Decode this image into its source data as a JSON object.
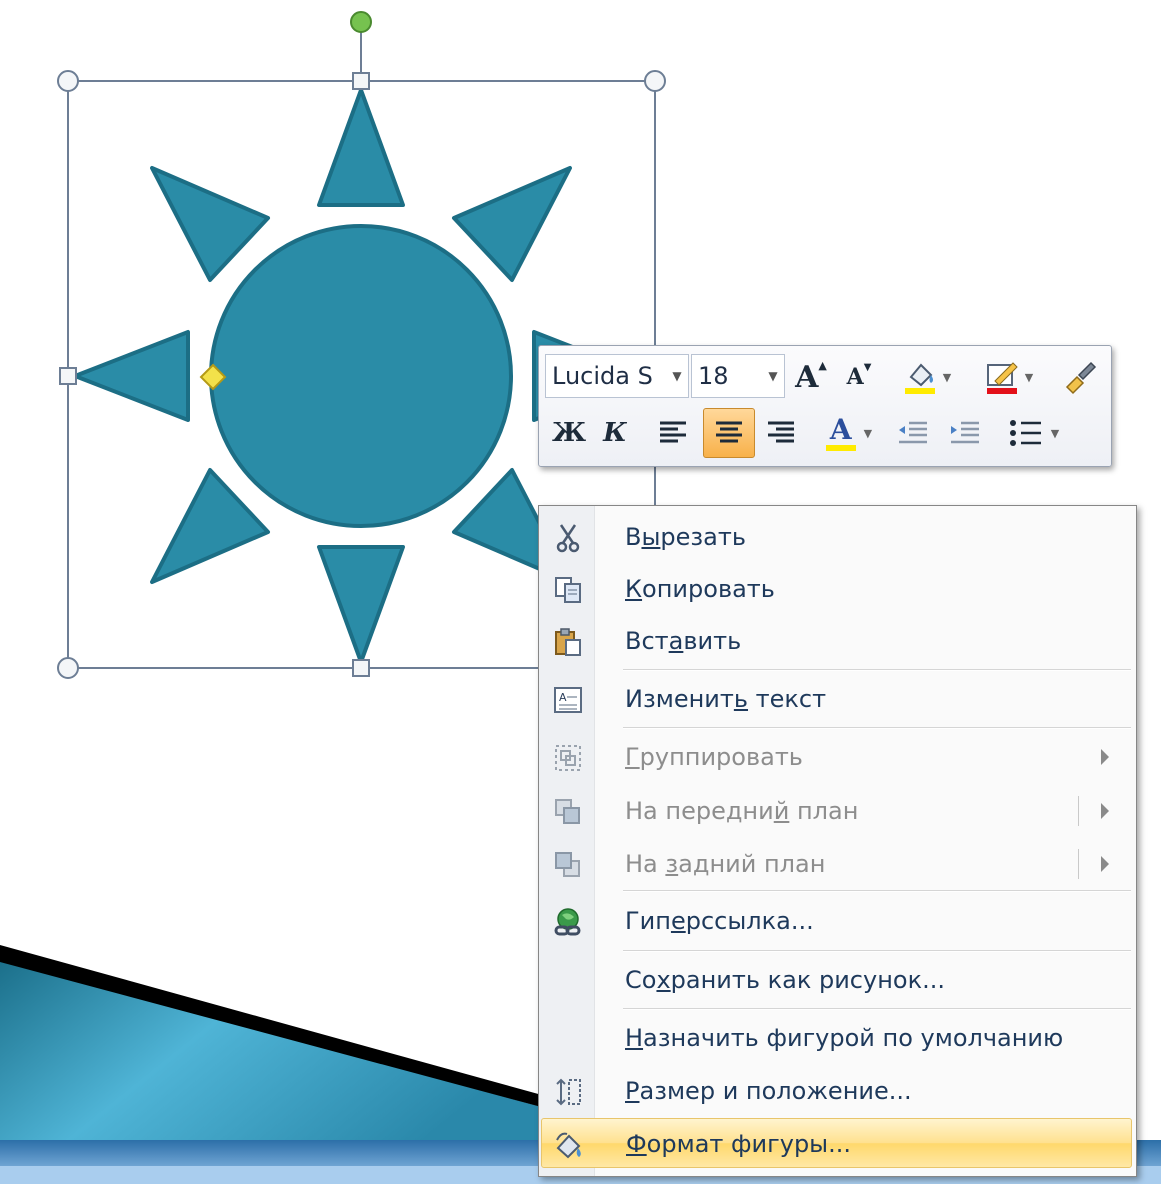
{
  "colors": {
    "shape_fill": "#2a8ca7",
    "shape_stroke": "#1c6e85",
    "menu_highlight": "#ffd86b",
    "menu_text": "#1e395b",
    "disabled_text": "#8d8d8d"
  },
  "mini_toolbar": {
    "font_name": "Lucida S",
    "font_size": "18",
    "row1_icons": [
      "grow-font-icon",
      "shrink-font-icon",
      "fill-color-icon",
      "line-color-icon",
      "format-painter-icon"
    ],
    "row2_icons": [
      "bold-icon",
      "italic-icon",
      "align-left-icon",
      "align-center-icon",
      "align-right-icon",
      "font-color-icon",
      "decrease-indent-icon",
      "increase-indent-icon",
      "bullets-icon"
    ],
    "bold_glyph": "Ж",
    "italic_glyph": "К",
    "font_color_glyph": "A",
    "grow_glyph": "A",
    "shrink_glyph": "A",
    "active_button": "align-center"
  },
  "context_menu": {
    "items": [
      {
        "key": "cut",
        "before": "В",
        "u": "ы",
        "after": "резать",
        "icon": "scissors-icon",
        "disabled": false
      },
      {
        "key": "copy",
        "before": "",
        "u": "К",
        "after": "опировать",
        "icon": "copy-icon",
        "disabled": false
      },
      {
        "key": "paste",
        "before": "Вст",
        "u": "а",
        "after": "вить",
        "icon": "paste-icon",
        "disabled": false
      },
      {
        "key": "edit-text",
        "before": "Изменит",
        "u": "ь",
        "after": " текст",
        "icon": "edit-text-icon",
        "disabled": false
      },
      {
        "key": "group",
        "before": "",
        "u": "Г",
        "after": "руппировать",
        "icon": "group-icon",
        "disabled": true,
        "submenu": true
      },
      {
        "key": "bring-front",
        "before": "На передни",
        "u": "й",
        "after": " план",
        "icon": "bring-front-icon",
        "disabled": true,
        "submenu": true
      },
      {
        "key": "send-back",
        "before": "На ",
        "u": "з",
        "after": "адний план",
        "icon": "send-back-icon",
        "disabled": true,
        "submenu": true
      },
      {
        "key": "hyperlink",
        "before": "Гип",
        "u": "е",
        "after": "рссылка...",
        "icon": "hyperlink-icon",
        "disabled": false
      },
      {
        "key": "save-as-picture",
        "before": "Со",
        "u": "х",
        "after": "ранить как рисунок...",
        "icon": "",
        "disabled": false
      },
      {
        "key": "set-default",
        "before": "",
        "u": "Н",
        "after": "азначить фигурой по умолчанию",
        "icon": "",
        "disabled": false
      },
      {
        "key": "size-position",
        "before": "",
        "u": "Р",
        "after": "азмер и положение...",
        "icon": "size-position-icon",
        "disabled": false
      },
      {
        "key": "format-shape",
        "before": "",
        "u": "Ф",
        "after": "ормат фигуры...",
        "icon": "format-shape-icon",
        "disabled": false,
        "highlighted": true
      }
    ]
  }
}
